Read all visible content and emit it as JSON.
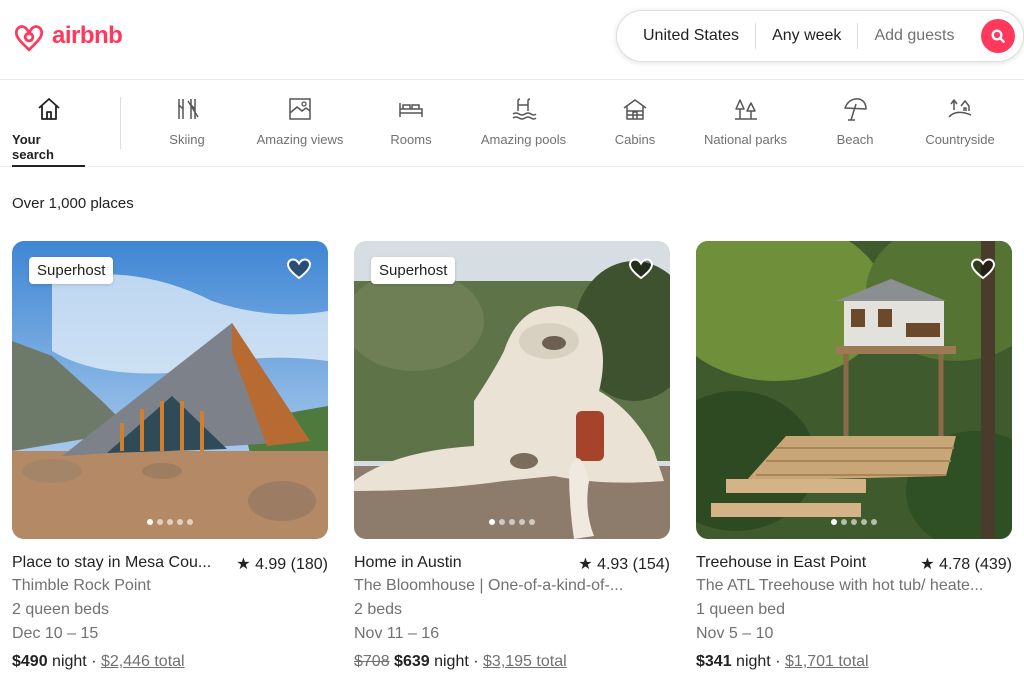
{
  "brand": {
    "name": "airbnb",
    "color": "#FF385C"
  },
  "search": {
    "location": "United States",
    "week": "Any week",
    "guests_placeholder": "Add guests"
  },
  "categories": [
    {
      "label": "Your search",
      "icon": "house-icon",
      "active": true
    },
    {
      "label": "Skiing",
      "icon": "skiing-icon"
    },
    {
      "label": "Amazing views",
      "icon": "framed-view-icon"
    },
    {
      "label": "Rooms",
      "icon": "bed-icon"
    },
    {
      "label": "Amazing pools",
      "icon": "pool-icon"
    },
    {
      "label": "Cabins",
      "icon": "cabin-icon"
    },
    {
      "label": "National parks",
      "icon": "trees-icon"
    },
    {
      "label": "Beach",
      "icon": "umbrella-icon"
    },
    {
      "label": "Countryside",
      "icon": "countryside-icon"
    }
  ],
  "results_count": "Over 1,000 places",
  "listings": [
    {
      "badge": "Superhost",
      "title": "Place to stay in Mesa Cou...",
      "rating": "4.99 (180)",
      "subtitle": "Thimble Rock Point",
      "beds": "2 queen beds",
      "dates": "Dec 10 – 15",
      "price": "$490",
      "unit": "night",
      "total": "$2,446 total",
      "image": "a-frame-cabin-photo"
    },
    {
      "badge": "Superhost",
      "title": "Home in Austin",
      "rating": "4.93 (154)",
      "subtitle": "The Bloomhouse | One-of-a-kind-of-...",
      "beds": "2 beds",
      "dates": "Nov 11 – 16",
      "original_price": "$708",
      "price": "$639",
      "unit": "night",
      "total": "$3,195 total",
      "image": "bloomhouse-photo"
    },
    {
      "title": "Treehouse in East Point",
      "rating": "4.78 (439)",
      "subtitle": "The ATL Treehouse with hot tub/ heate...",
      "beds": "1 queen bed",
      "dates": "Nov 5 – 10",
      "price": "$341",
      "unit": "night",
      "total": "$1,701 total",
      "image": "treehouse-photo"
    }
  ]
}
